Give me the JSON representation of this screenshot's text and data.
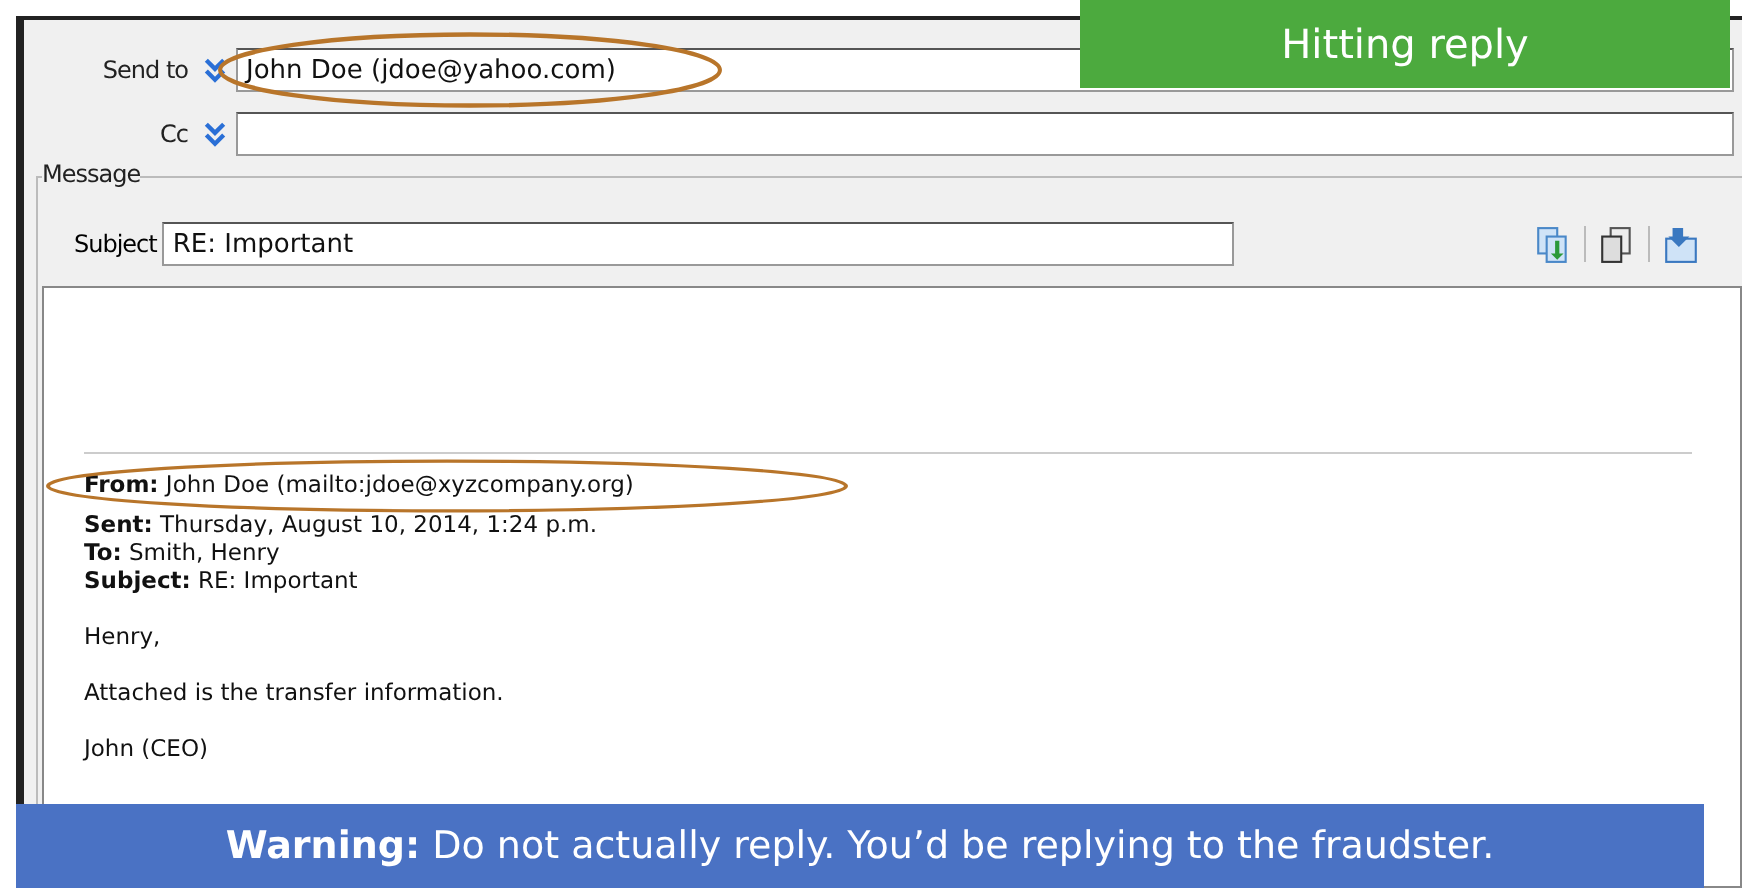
{
  "banner": {
    "text": "Hitting reply"
  },
  "compose": {
    "send_to": {
      "label": "Send to",
      "value": "John Doe (jdoe@yahoo.com)"
    },
    "cc": {
      "label": "Cc"
    },
    "message_group": {
      "label": "Message"
    },
    "subject": {
      "label": "Subject",
      "value": "RE: Important"
    }
  },
  "body": {
    "header_lines": [
      "**From:** John Doe (mailto:jdoe@xyzcompany.org)",
      "**Sent:** Thursday, August 10, 2014, 1:24 p.m.",
      "**To:** Smith, Henry",
      "**Subject:** RE: Important"
    ],
    "paragraphs": [
      "Henry,",
      "Attached is the transfer information.",
      "John (CEO)"
    ]
  },
  "warning": "**Warning:** Do not actually reply. You’d be replying to the fraudster."
}
